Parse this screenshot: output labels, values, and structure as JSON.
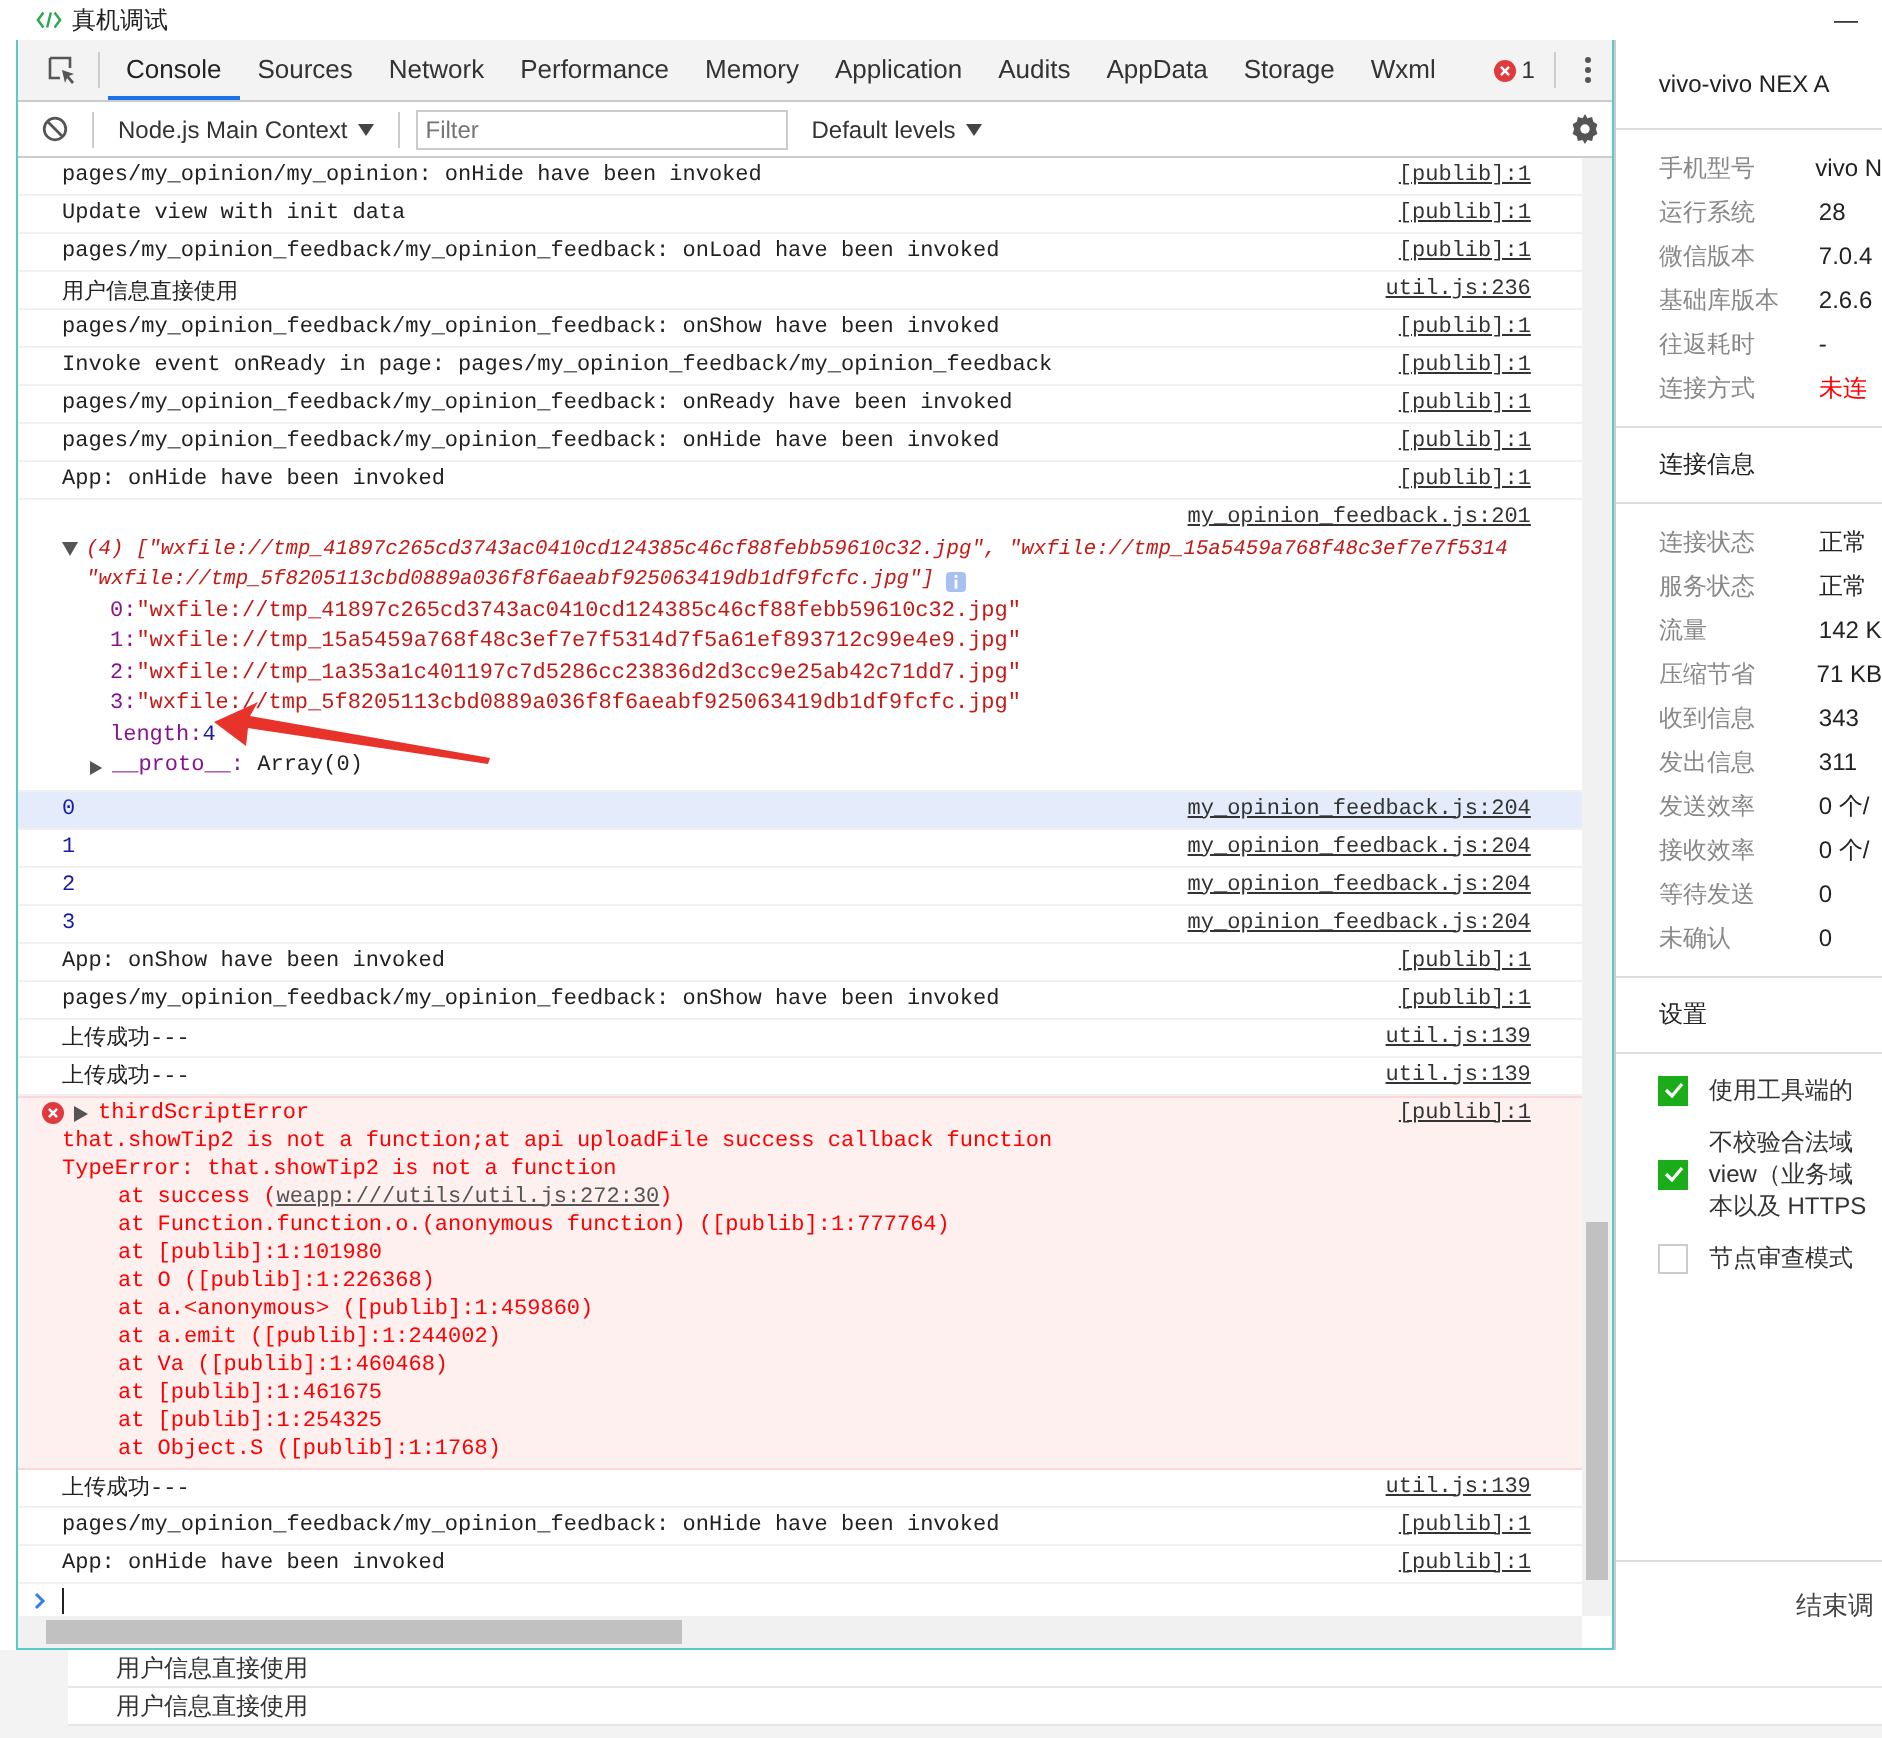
{
  "window": {
    "title": "真机调试",
    "minimize": "—"
  },
  "tabs": [
    {
      "label": "Console",
      "selected": true
    },
    {
      "label": "Sources",
      "selected": false
    },
    {
      "label": "Network",
      "selected": false
    },
    {
      "label": "Performance",
      "selected": false
    },
    {
      "label": "Memory",
      "selected": false
    },
    {
      "label": "Application",
      "selected": false
    },
    {
      "label": "Audits",
      "selected": false
    },
    {
      "label": "AppData",
      "selected": false
    },
    {
      "label": "Storage",
      "selected": false
    },
    {
      "label": "Wxml",
      "selected": false
    }
  ],
  "error_count": "1",
  "toolbar": {
    "context": "Node.js Main Context",
    "filter_placeholder": "Filter",
    "levels": "Default levels"
  },
  "messages": [
    {
      "kind": "log",
      "text": "pages/my_opinion/my_opinion: onHide have been invoked",
      "source": "[publib]:1",
      "highlighted": false
    },
    {
      "kind": "log",
      "text": "Update view with init data",
      "source": "[publib]:1",
      "highlighted": false
    },
    {
      "kind": "log",
      "text": "pages/my_opinion_feedback/my_opinion_feedback: onLoad have been invoked",
      "source": "[publib]:1",
      "highlighted": false
    },
    {
      "kind": "log",
      "text": "用户信息直接使用",
      "source": "util.js:236",
      "highlighted": false
    },
    {
      "kind": "log",
      "text": "pages/my_opinion_feedback/my_opinion_feedback: onShow have been invoked",
      "source": "[publib]:1",
      "highlighted": false
    },
    {
      "kind": "log",
      "text": "Invoke event onReady in page: pages/my_opinion_feedback/my_opinion_feedback",
      "source": "[publib]:1",
      "highlighted": false
    },
    {
      "kind": "log",
      "text": "pages/my_opinion_feedback/my_opinion_feedback: onReady have been invoked",
      "source": "[publib]:1",
      "highlighted": false
    },
    {
      "kind": "log",
      "text": "pages/my_opinion_feedback/my_opinion_feedback: onHide have been invoked",
      "source": "[publib]:1",
      "highlighted": false
    },
    {
      "kind": "log",
      "text": "App: onHide have been invoked",
      "source": "[publib]:1",
      "highlighted": false
    },
    {
      "kind": "array",
      "source": "my_opinion_feedback.js:201",
      "highlighted": false,
      "expanded": true,
      "summary": [
        "(4) [\"wxfile://tmp_41897c265cd3743ac0410cd124385c46cf88febb59610c32.jpg\", \"wxfile://tmp_15a5459a768f48c3ef7e7f5314",
        "\"wxfile://tmp_5f8205113cbd0889a036f8f6aeabf925063419db1df9fcfc.jpg\"]"
      ],
      "entries": [
        {
          "index": "0:",
          "value": "\"wxfile://tmp_41897c265cd3743ac0410cd124385c46cf88febb59610c32.jpg\""
        },
        {
          "index": "1:",
          "value": "\"wxfile://tmp_15a5459a768f48c3ef7e7f5314d7f5a61ef893712c99e4e9.jpg\""
        },
        {
          "index": "2:",
          "value": "\"wxfile://tmp_1a353a1c401197c7d5286cc23836d2d3cc9e25ab42c71dd7.jpg\""
        },
        {
          "index": "3:",
          "value": "\"wxfile://tmp_5f8205113cbd0889a036f8f6aeabf925063419db1df9fcfc.jpg\""
        }
      ],
      "length_key": "length:",
      "length": "4",
      "proto_key": "__proto__:",
      "proto": "Array(0)"
    },
    {
      "kind": "number",
      "text": "0",
      "source": "my_opinion_feedback.js:204",
      "highlighted": true
    },
    {
      "kind": "number",
      "text": "1",
      "source": "my_opinion_feedback.js:204",
      "highlighted": false
    },
    {
      "kind": "number",
      "text": "2",
      "source": "my_opinion_feedback.js:204",
      "highlighted": false
    },
    {
      "kind": "number",
      "text": "3",
      "source": "my_opinion_feedback.js:204",
      "highlighted": false
    },
    {
      "kind": "log",
      "text": "App: onShow have been invoked",
      "source": "[publib]:1",
      "highlighted": false
    },
    {
      "kind": "log",
      "text": "pages/my_opinion_feedback/my_opinion_feedback: onShow have been invoked",
      "source": "[publib]:1",
      "highlighted": false
    },
    {
      "kind": "log",
      "text": "上传成功---",
      "source": "util.js:139",
      "highlighted": false
    },
    {
      "kind": "log",
      "text": "上传成功---",
      "source": "util.js:139",
      "highlighted": false
    },
    {
      "kind": "error",
      "title": "thirdScriptError",
      "source": "[publib]:1",
      "highlighted": false,
      "lines": [
        "that.showTip2 is not a function;at api uploadFile success callback function",
        "TypeError: that.showTip2 is not a function"
      ],
      "stack": [
        {
          "text": "at success (",
          "link": "weapp:///utils/util.js:272:30",
          "after": ")"
        },
        {
          "text": "at Function.function.o.(anonymous function) ([publib]:1:777764)"
        },
        {
          "text": "at [publib]:1:101980"
        },
        {
          "text": "at O ([publib]:1:226368)"
        },
        {
          "text": "at a.<anonymous> ([publib]:1:459860)"
        },
        {
          "text": "at a.emit ([publib]:1:244002)"
        },
        {
          "text": "at Va ([publib]:1:460468)"
        },
        {
          "text": "at [publib]:1:461675"
        },
        {
          "text": "at [publib]:1:254325"
        },
        {
          "text": "at Object.S ([publib]:1:1768)"
        }
      ]
    },
    {
      "kind": "log",
      "text": "上传成功---",
      "source": "util.js:139",
      "highlighted": false
    },
    {
      "kind": "log",
      "text": "pages/my_opinion_feedback/my_opinion_feedback: onHide have been invoked",
      "source": "[publib]:1",
      "highlighted": false
    },
    {
      "kind": "log",
      "text": "App: onHide have been invoked",
      "source": "[publib]:1",
      "highlighted": false
    }
  ],
  "side_panel": {
    "device": "vivo-vivo NEX A",
    "info": [
      {
        "label": "手机型号",
        "value": "vivo N",
        "alert": false
      },
      {
        "label": "运行系统",
        "value": "28",
        "alert": false
      },
      {
        "label": "微信版本",
        "value": "7.0.4",
        "alert": false
      },
      {
        "label": "基础库版本",
        "value": "2.6.6",
        "alert": false
      },
      {
        "label": "往返耗时",
        "value": "-",
        "alert": false
      },
      {
        "label": "连接方式",
        "value": "未连",
        "alert": true
      }
    ],
    "connection_title": "连接信息",
    "connection": [
      {
        "label": "连接状态",
        "value": "正常",
        "alert": false
      },
      {
        "label": "服务状态",
        "value": "正常",
        "alert": false
      },
      {
        "label": "流量",
        "value": "142 K",
        "alert": false
      },
      {
        "label": "压缩节省",
        "value": "71 KB",
        "alert": false
      },
      {
        "label": "收到信息",
        "value": "343",
        "alert": false
      },
      {
        "label": "发出信息",
        "value": "311",
        "alert": false
      },
      {
        "label": "发送效率",
        "value": "0 个/",
        "alert": false
      },
      {
        "label": "接收效率",
        "value": "0 个/",
        "alert": false
      },
      {
        "label": "等待发送",
        "value": "0",
        "alert": false
      },
      {
        "label": "未确认",
        "value": "0",
        "alert": false
      }
    ],
    "settings_title": "设置",
    "settings": [
      {
        "lines": [
          "使用工具端的"
        ],
        "checked": true
      },
      {
        "lines": [
          "不校验合法域",
          "view（业务域",
          "本以及 HTTPS"
        ],
        "checked": true
      },
      {
        "lines": [
          "节点审查模式"
        ],
        "checked": false
      }
    ],
    "end_button": "结束调"
  },
  "background_rows": [
    "用户信息直接使用",
    "用户信息直接使用"
  ]
}
